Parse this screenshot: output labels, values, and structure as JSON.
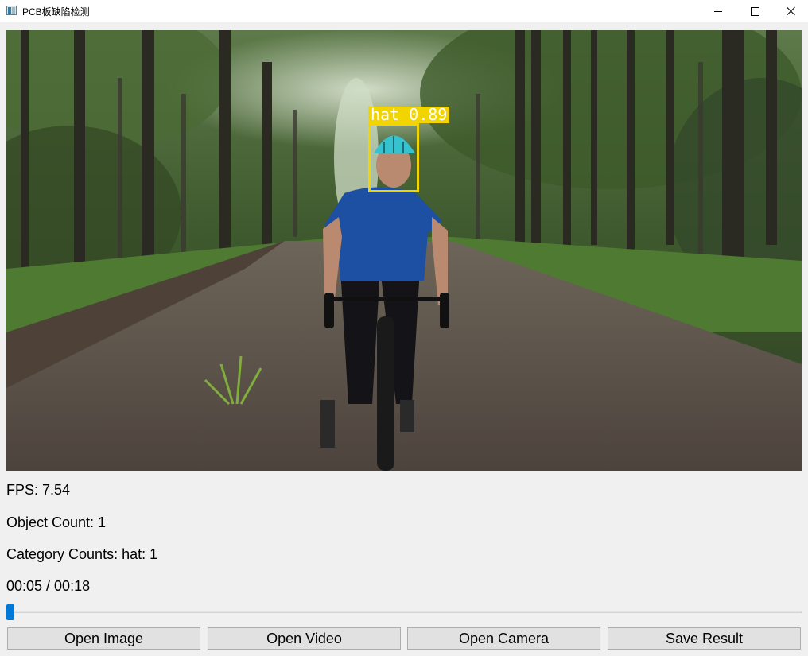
{
  "window": {
    "title": "PCB板缺陷检测"
  },
  "detection": {
    "label": "hat 0.89",
    "box_color": "#f2d400"
  },
  "info": {
    "fps": "FPS: 7.54",
    "object_count": "Object Count: 1",
    "category_counts": "Category Counts: hat: 1",
    "time": "00:05 / 00:18"
  },
  "playback": {
    "position_seconds": 5,
    "duration_seconds": 18,
    "accent_color": "#0078d7"
  },
  "buttons": {
    "open_image": "Open Image",
    "open_video": "Open Video",
    "open_camera": "Open Camera",
    "save_result": "Save Result"
  }
}
